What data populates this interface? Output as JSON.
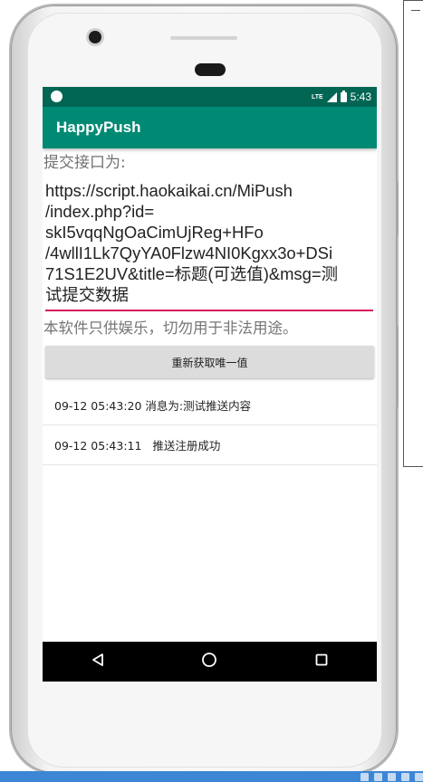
{
  "status_bar": {
    "network": "LTE",
    "time": "5:43"
  },
  "app_bar": {
    "title": "HappyPush"
  },
  "form": {
    "label": "提交接口为:",
    "url_value": "https://script.haokaikai.cn/MiPush\n/index.php?id=\nskI5vqqNgOaCimUjReg+HFo\n/4wllI1Lk7QyYA0Flzw4NI0Kgxx3o+DSi\n71S1E2UV&title=标题(可选值)&msg=测\n试提交数据",
    "disclaimer": "本软件只供娱乐，切勿用于非法用途。"
  },
  "action_button": {
    "label": "重新获取唯一值"
  },
  "log": [
    {
      "text": "09-12 05:43:20 消息为:测试推送内容"
    },
    {
      "text": "09-12 05:43:11   推送注册成功"
    }
  ],
  "colors": {
    "status_bar": "#006653",
    "app_bar": "#008a74",
    "input_underline": "#d81b60"
  },
  "icons": {
    "back": "back-triangle-icon",
    "home": "home-circle-icon",
    "recents": "recents-square-icon"
  }
}
